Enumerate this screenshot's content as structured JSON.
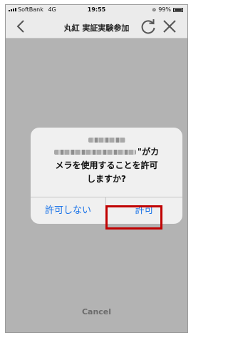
{
  "status_bar": {
    "carrier": "SoftBank",
    "network": "4G",
    "time": "19:55",
    "battery": "99%"
  },
  "nav": {
    "title": "丸紅 実証実験参加",
    "back_icon": "chevron-left-icon",
    "reload_icon": "reload-icon",
    "close_icon": "close-icon"
  },
  "dialog": {
    "message_suffix": "\"がカ",
    "message_line2": "メラを使用することを許可",
    "message_line3": "しますか?",
    "deny_label": "許可しない",
    "allow_label": "許可"
  },
  "footer": {
    "cancel_label": "Cancel"
  },
  "colors": {
    "accent": "#1a73e8",
    "highlight": "#c00000",
    "overlay": "#b3b3b3"
  }
}
